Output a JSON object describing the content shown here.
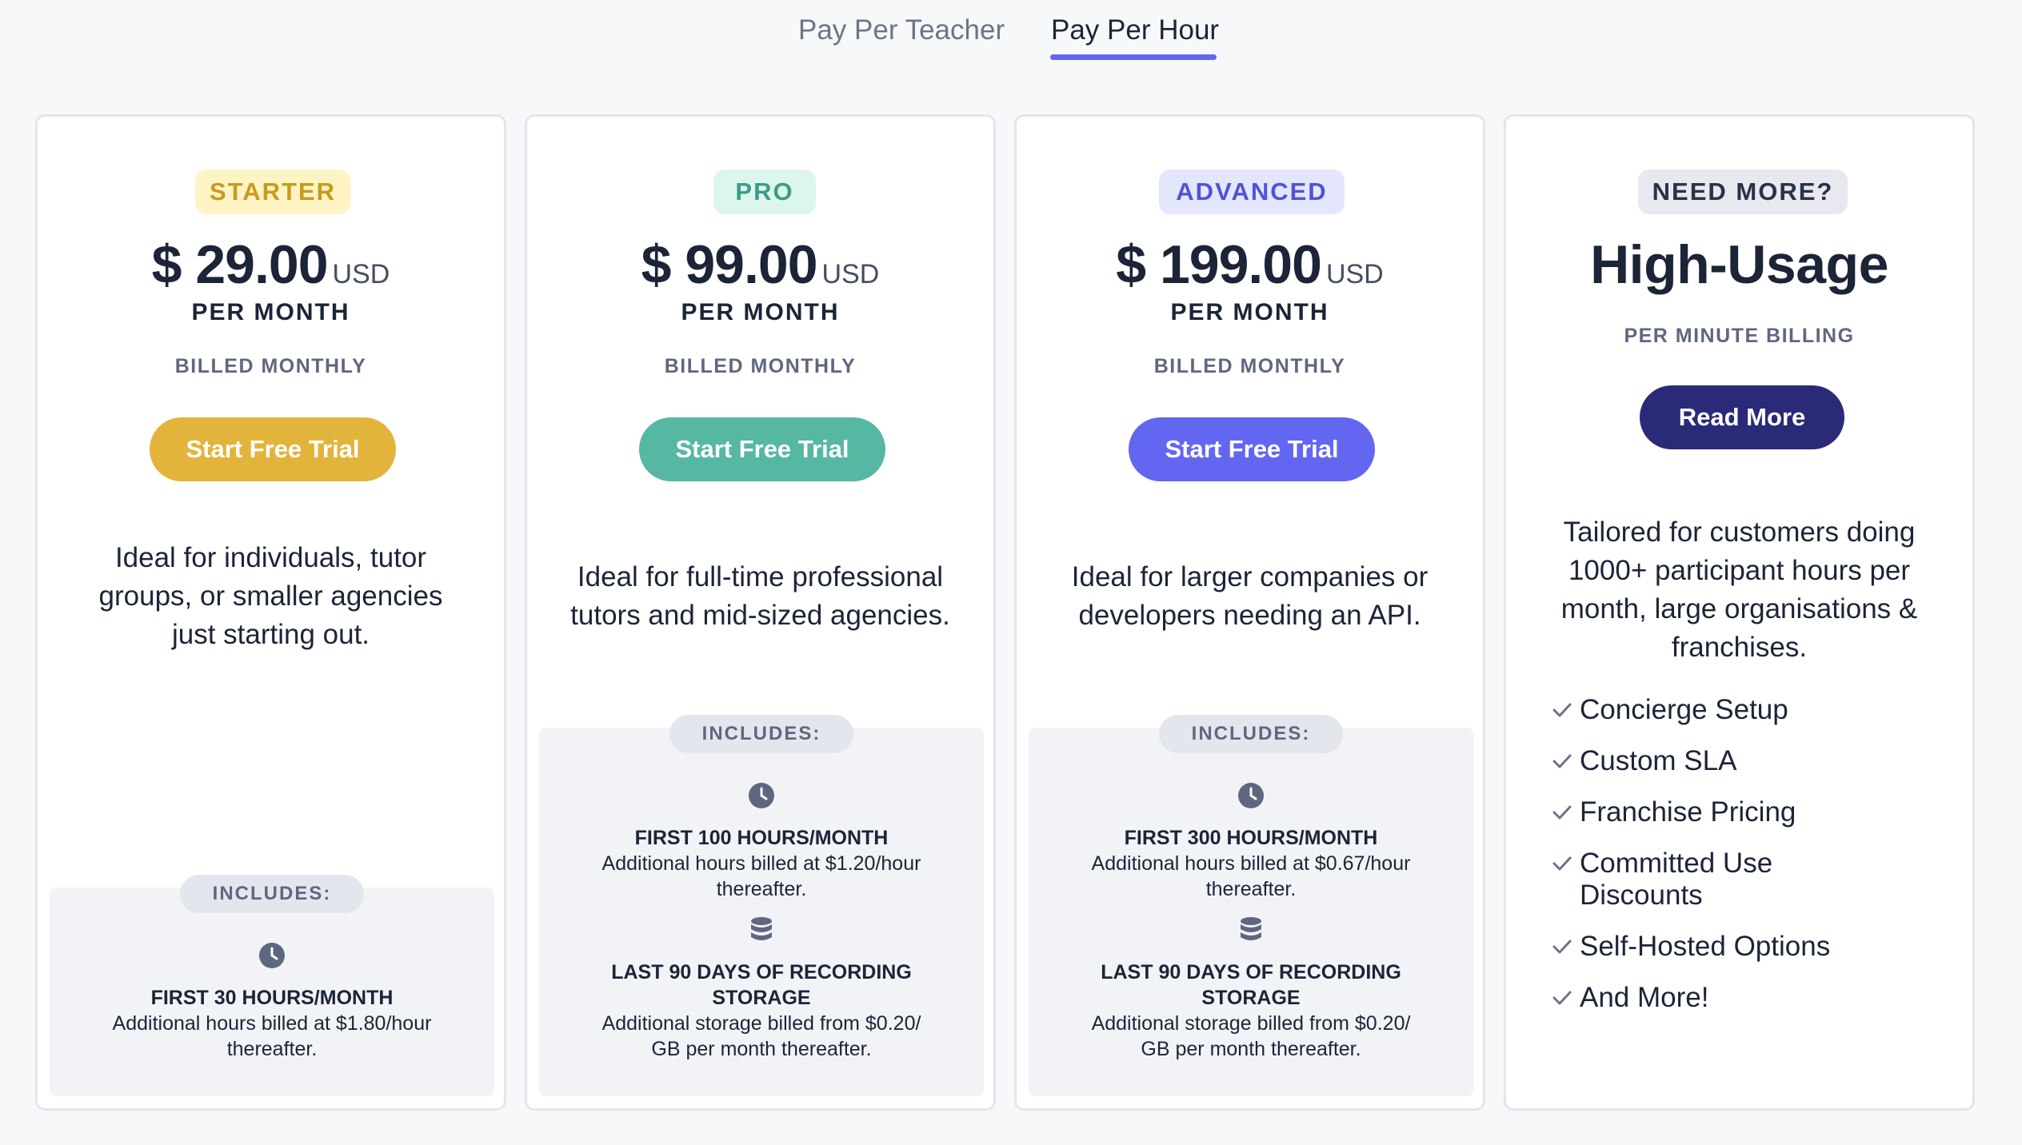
{
  "colors": {
    "accent": "#6366f1",
    "starter": "#e3b43c",
    "pro": "#56b7a3",
    "advanced": "#6366f1",
    "high_usage": "#2b2a78"
  },
  "tabs": [
    {
      "label": "Pay Per Teacher",
      "active": false
    },
    {
      "label": "Pay Per Hour",
      "active": true
    }
  ],
  "plans": [
    {
      "badge": "STARTER",
      "price": "$ 29.00",
      "currency": "USD",
      "period": "PER MONTH",
      "billing": "BILLED MONTHLY",
      "cta": "Start Free Trial",
      "description": [
        "Ideal for individuals, tutor",
        "groups, or smaller agencies",
        "just starting out."
      ],
      "includes_label": "INCLUDES:",
      "includes": [
        {
          "icon": "clock-icon",
          "title": "FIRST 30 HOURS/MONTH",
          "text": [
            "Additional hours billed at $1.80/hour",
            "thereafter."
          ]
        }
      ]
    },
    {
      "badge": "PRO",
      "price": "$ 99.00",
      "currency": "USD",
      "period": "PER MONTH",
      "billing": "BILLED MONTHLY",
      "cta": "Start Free Trial",
      "description": [
        "Ideal for full-time professional",
        "tutors and mid-sized agencies."
      ],
      "includes_label": "INCLUDES:",
      "includes": [
        {
          "icon": "clock-icon",
          "title": "FIRST 100 HOURS/MONTH",
          "text": [
            "Additional hours billed at $1.20/hour",
            "thereafter."
          ]
        },
        {
          "icon": "database-icon",
          "title": [
            "LAST 90 DAYS OF RECORDING",
            "STORAGE"
          ],
          "text": [
            "Additional storage billed from $0.20/",
            "GB per month thereafter."
          ]
        }
      ]
    },
    {
      "badge": "ADVANCED",
      "price": "$ 199.00",
      "currency": "USD",
      "period": "PER MONTH",
      "billing": "BILLED MONTHLY",
      "cta": "Start Free Trial",
      "description": [
        "Ideal for larger companies or",
        "developers needing an API."
      ],
      "includes_label": "INCLUDES:",
      "includes": [
        {
          "icon": "clock-icon",
          "title": "FIRST 300 HOURS/MONTH",
          "text": [
            "Additional hours billed at $0.67/hour",
            "thereafter."
          ]
        },
        {
          "icon": "database-icon",
          "title": [
            "LAST 90 DAYS OF RECORDING",
            "STORAGE"
          ],
          "text": [
            "Additional storage billed from $0.20/",
            "GB per month thereafter."
          ]
        }
      ]
    },
    {
      "badge": "NEED MORE?",
      "headline": "High-Usage",
      "billing": "PER MINUTE BILLING",
      "cta": "Read More",
      "description": [
        "Tailored for customers doing",
        "1000+ participant hours per",
        "month, large organisations &",
        "franchises."
      ],
      "features": [
        "Concierge Setup",
        "Custom SLA",
        "Franchise Pricing",
        [
          "Committed Use",
          "Discounts"
        ],
        "Self-Hosted Options",
        "And More!"
      ]
    }
  ]
}
